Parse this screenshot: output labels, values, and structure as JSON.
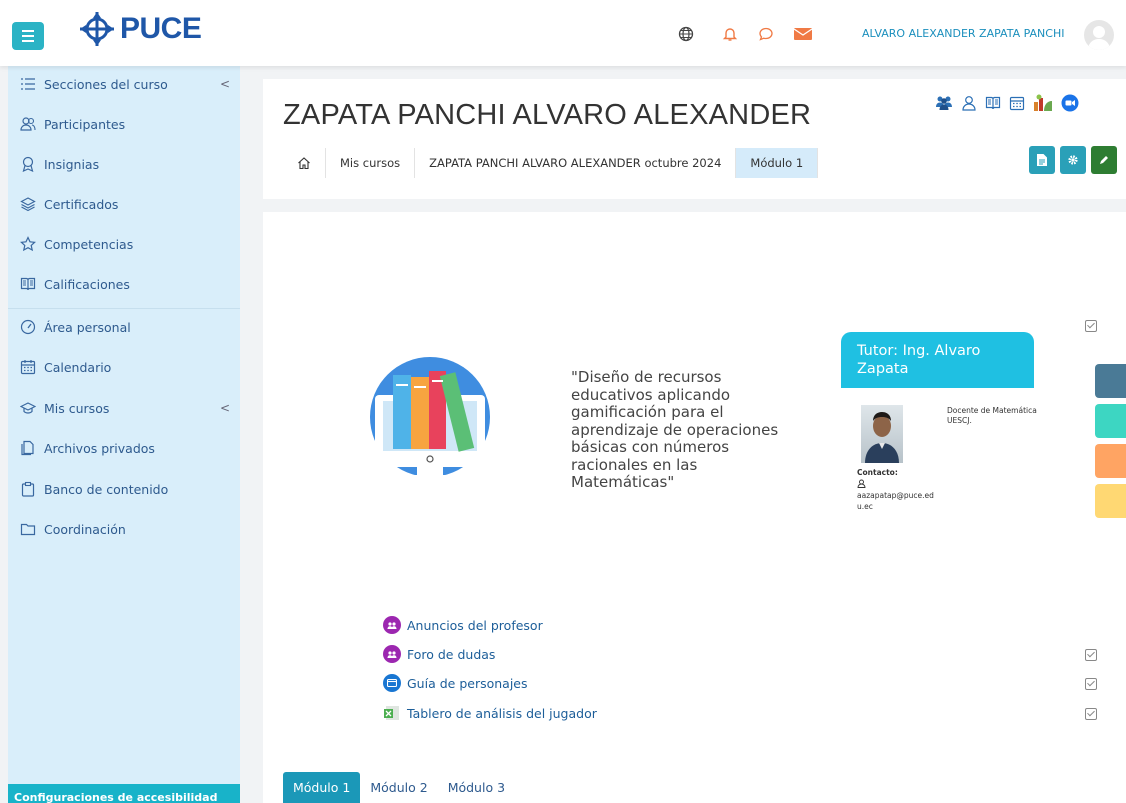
{
  "brand": {
    "logo_text": "PUCE"
  },
  "topbar": {
    "icons": [
      "globe-icon",
      "bell-icon",
      "chat-icon",
      "mail-icon"
    ],
    "username": "ALVARO ALEXANDER ZAPATA PANCHI"
  },
  "sidebar": {
    "items": [
      {
        "label": "Secciones del curso",
        "icon": "list-icon",
        "has_arrow": true
      },
      {
        "label": "Participantes",
        "icon": "users-icon"
      },
      {
        "label": "Insignias",
        "icon": "badge-icon"
      },
      {
        "label": "Certificados",
        "icon": "layers-icon"
      },
      {
        "label": "Competencias",
        "icon": "star-icon"
      },
      {
        "label": "Calificaciones",
        "icon": "book-icon"
      },
      {
        "label": "Área personal",
        "icon": "gauge-icon"
      },
      {
        "label": "Calendario",
        "icon": "calendar-icon"
      },
      {
        "label": "Mis cursos",
        "icon": "graduation-icon",
        "has_arrow": true
      },
      {
        "label": "Archivos privados",
        "icon": "files-icon"
      },
      {
        "label": "Banco de contenido",
        "icon": "clipboard-icon"
      },
      {
        "label": "Coordinación",
        "icon": "folder-icon"
      }
    ],
    "arrow": "<",
    "accessibility_label": "Configuraciones de accesibilidad"
  },
  "header": {
    "title": "ZAPATA PANCHI ALVARO ALEXANDER",
    "breadcrumb": [
      "Mis cursos",
      "ZAPATA PANCHI ALVARO ALEXANDER octubre 2024",
      "Módulo 1"
    ],
    "icons": [
      "group-icon",
      "user-icon",
      "book-icon",
      "calendar-icon",
      "chart-icon",
      "video-icon"
    ],
    "buttons": [
      "document-icon",
      "gear-icon",
      "pencil-icon"
    ]
  },
  "course": {
    "description": "\"Diseño de recursos educativos aplicando gamificación para el aprendizaje de operaciones básicas con números racionales en las Matemáticas\"",
    "tutor_title": "Tutor: Ing. Alvaro Zapata",
    "tutor_role": "Docente de Matemática UESCJ.",
    "contact_label": "Contacto:",
    "contact_email": "aazapatap@puce.edu.ec"
  },
  "side_tab_colors": [
    "#4a7a96",
    "#3dd6c2",
    "#ffa463",
    "#ffd873"
  ],
  "activities": [
    {
      "label": "Anuncios del profesor",
      "icon": "forum-icon",
      "color": "#9c27b0"
    },
    {
      "label": "Foro de dudas",
      "icon": "forum-icon",
      "color": "#9c27b0"
    },
    {
      "label": "Guía de personajes",
      "icon": "page-icon",
      "color": "#1976d2"
    },
    {
      "label": "Tablero de análisis del jugador",
      "icon": "spreadsheet-icon",
      "color": "#4caf50"
    }
  ],
  "module_tabs": [
    "Módulo 1",
    "Módulo 2",
    "Módulo 3"
  ],
  "colors": {
    "accent": "#2bb3c5",
    "sidebar_bg": "#d9eefa",
    "link": "#2e5a8e",
    "edit_green": "#2e7d32"
  }
}
